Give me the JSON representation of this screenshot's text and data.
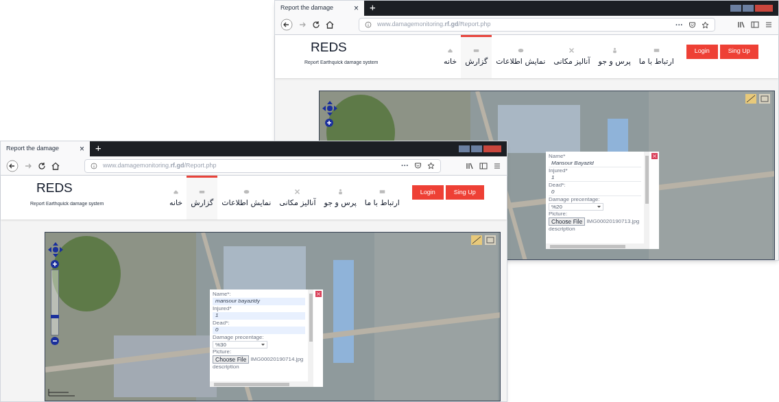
{
  "windows": [
    {
      "tab_title": "Report the damage",
      "tab_close": "×",
      "new_tab": "+",
      "url": "www.damagemonitoring.**rf.gd**/Report.php",
      "page_actions": "···",
      "brand": "REDS",
      "tagline": "Report Earthquick damage system",
      "nav": [
        {
          "label": "ارتباط با ما",
          "selected": false
        },
        {
          "label": "پرس و جو",
          "selected": false
        },
        {
          "label": "آنالیز مکانی",
          "selected": false
        },
        {
          "label": "نمایش اطلاعات",
          "selected": false
        },
        {
          "label": "گزارش",
          "selected": true
        },
        {
          "label": "خانه",
          "selected": false
        }
      ],
      "buttons": [
        "Login",
        "Sing Up"
      ],
      "popup": {
        "fields": [
          {
            "kind": "text",
            "label": "Name*",
            "value": "Mansour Bayazid",
            "autofilled": false
          },
          {
            "kind": "text",
            "label": "Injured*",
            "value": "1",
            "autofilled": false
          },
          {
            "kind": "text",
            "label": "Dead*:",
            "value": "0",
            "autofilled": false
          },
          {
            "kind": "select",
            "label": "Damage precentage:",
            "value": "%20"
          },
          {
            "kind": "file",
            "label": "Picture:",
            "button": "Choose File",
            "filename": "IMG00020190713.jpg"
          },
          {
            "kind": "label",
            "label": "description"
          }
        ]
      }
    },
    {
      "tab_title": "Report the damage",
      "tab_close": "×",
      "new_tab": "+",
      "url": "www.damagemonitoring.**rf.gd**/Report.php",
      "page_actions": "···",
      "brand": "REDS",
      "tagline": "Report Earthquick damage system",
      "nav": [
        {
          "label": "ارتباط با ما",
          "selected": false
        },
        {
          "label": "پرس و جو",
          "selected": false
        },
        {
          "label": "آنالیز مکانی",
          "selected": false
        },
        {
          "label": "نمایش اطلاعات",
          "selected": false
        },
        {
          "label": "گزارش",
          "selected": true
        },
        {
          "label": "خانه",
          "selected": false
        }
      ],
      "buttons": [
        "Login",
        "Sing Up"
      ],
      "zoom_slider": {
        "level": 0.27
      },
      "popup": {
        "fields": [
          {
            "kind": "text",
            "label": "Name*:",
            "value": "mansour bayazidy",
            "autofilled": true
          },
          {
            "kind": "text",
            "label": "Injured*",
            "value": "1",
            "autofilled": true
          },
          {
            "kind": "text",
            "label": "Dead*:",
            "value": "0",
            "autofilled": true
          },
          {
            "kind": "select",
            "label": "Damage precentage:",
            "value": "%30"
          },
          {
            "kind": "file",
            "label": "Picture:",
            "button": "Choose File",
            "filename": "IMG00020190714.jpg"
          },
          {
            "kind": "label",
            "label": "description"
          }
        ]
      }
    }
  ]
}
